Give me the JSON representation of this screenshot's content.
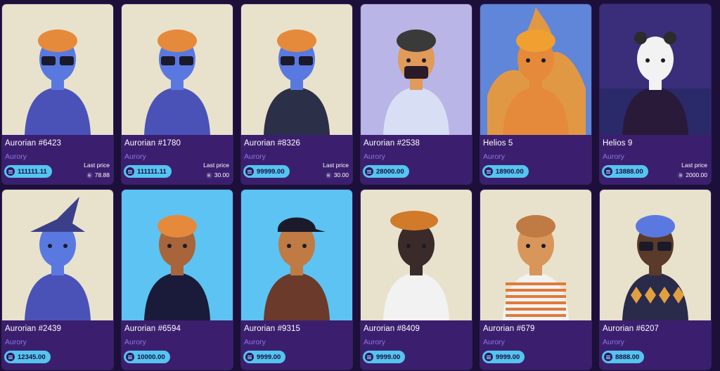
{
  "cards": [
    {
      "title": "Aurorian #6423",
      "collection": "Aurory",
      "price": "111111.11",
      "last_label": "Last price",
      "last_price": "78.88",
      "bg": "#e8e2cc",
      "skin": "#5a79e0",
      "hair": "#e58a3b",
      "shirt": "#4a52b8",
      "accessory": "glasses"
    },
    {
      "title": "Aurorian #1780",
      "collection": "Aurory",
      "price": "111111.11",
      "last_label": "Last price",
      "last_price": "30.00",
      "bg": "#e8e2cc",
      "skin": "#5a79e0",
      "hair": "#e58a3b",
      "shirt": "#4a52b8",
      "accessory": "glasses"
    },
    {
      "title": "Aurorian #8326",
      "collection": "Aurory",
      "price": "99999.00",
      "last_label": "Last price",
      "last_price": "30.00",
      "bg": "#e8e2cc",
      "skin": "#5a79e0",
      "hair": "#e58a3b",
      "shirt": "#2b2f48",
      "accessory": "goggles"
    },
    {
      "title": "Aurorian #2538",
      "collection": "Aurory",
      "price": "28000.00",
      "bg": "#b9b5e6",
      "skin": "#e09a5a",
      "hair": "#3a3a3a",
      "shirt": "#d8dff5",
      "accessory": "mask"
    },
    {
      "title": "Helios 5",
      "collection": "Aurory",
      "price": "18900.00",
      "bg": "#5f86d8",
      "skin": "#e58a3b",
      "hair": "#f0a030",
      "shirt": "#e58a3b",
      "accessory": "fire"
    },
    {
      "title": "Helios 9",
      "collection": "Aurory",
      "price": "13888.00",
      "last_label": "Last price",
      "last_price": "2000.00",
      "bg": "#3a2e7a",
      "skin": "#f2f2f2",
      "hair": "#2b2b2b",
      "shirt": "#2a1a3a",
      "accessory": "panda"
    },
    {
      "title": "Aurorian #2439",
      "collection": "Aurory",
      "price": "12345.00",
      "bg": "#e8e2cc",
      "skin": "#5a79e0",
      "hair": "#3b3f8a",
      "shirt": "#4a52b8",
      "accessory": "witch"
    },
    {
      "title": "Aurorian #6594",
      "collection": "Aurory",
      "price": "10000.00",
      "bg": "#5cc3f2",
      "skin": "#a8643a",
      "hair": "#e58a3b",
      "shirt": "#1a1a3a",
      "accessory": "hoodie"
    },
    {
      "title": "Aurorian #9315",
      "collection": "Aurory",
      "price": "9999.00",
      "bg": "#5cc3f2",
      "skin": "#c07a44",
      "hair": "#1a1a2a",
      "shirt": "#6b3a2a",
      "accessory": "cap"
    },
    {
      "title": "Aurorian #8409",
      "collection": "Aurory",
      "price": "9999.00",
      "bg": "#e8e2cc",
      "skin": "#3a2a2a",
      "hair": "#d07a2a",
      "shirt": "#f2f2f2",
      "accessory": "beret"
    },
    {
      "title": "Aurorian #679",
      "collection": "Aurory",
      "price": "9999.00",
      "bg": "#e8e2cc",
      "skin": "#d9965a",
      "hair": "#c07a44",
      "shirt": "#f2f2f2",
      "accessory": "stripes"
    },
    {
      "title": "Aurorian #6207",
      "collection": "Aurory",
      "price": "8888.00",
      "bg": "#e8e2cc",
      "skin": "#5a3a2a",
      "hair": "#5a79e0",
      "shirt": "#2a2a4a",
      "accessory": "diamonds"
    }
  ]
}
